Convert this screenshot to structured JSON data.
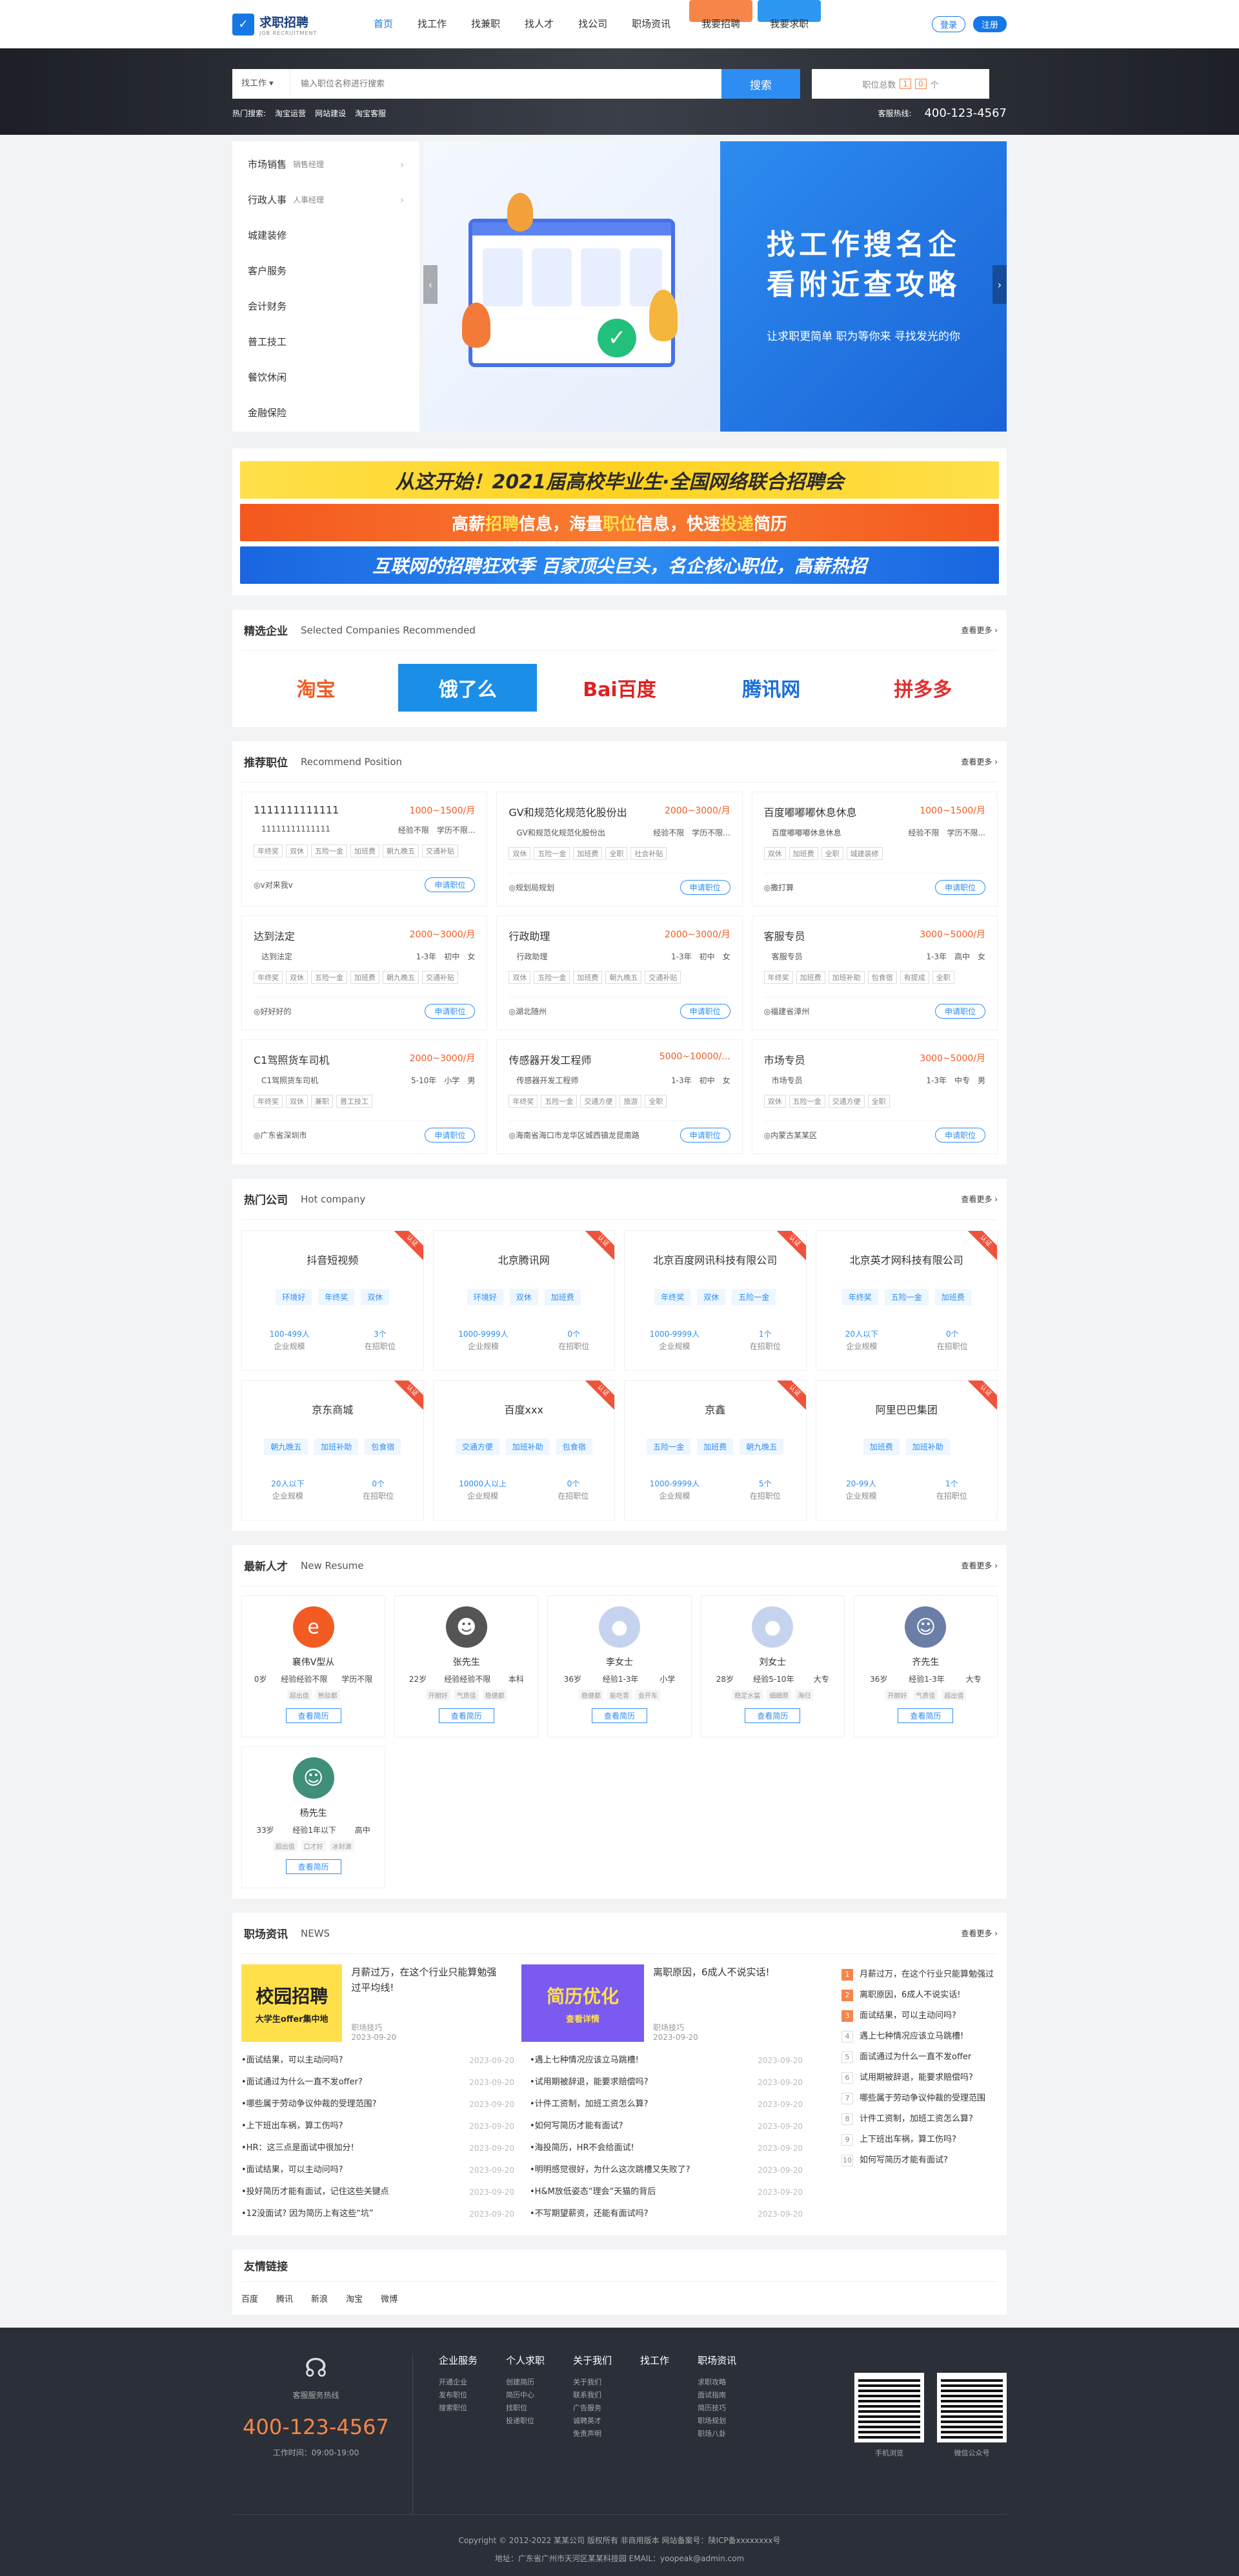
{
  "header": {
    "logo_main": "求职招聘",
    "logo_sub": "JOB RECRUITMENT",
    "nav": [
      "首页",
      "找工作",
      "找兼职",
      "找人才",
      "找公司",
      "职场资讯"
    ],
    "btn_recruit": "我要招聘",
    "btn_job": "我要求职",
    "login": "登录",
    "register": "注册"
  },
  "search": {
    "type": "找工作",
    "placeholder": "输入职位名称进行搜索",
    "button": "搜索",
    "total_label": "职位总数",
    "total_digits": [
      "1",
      "0"
    ],
    "total_unit": "个",
    "hot_label": "热门搜索:",
    "hot_terms": [
      "淘宝运营",
      "网站建设",
      "淘宝客服"
    ],
    "hotline_label": "客服热线:",
    "hotline": "400-123-4567"
  },
  "categories": [
    {
      "name": "市场销售",
      "sub": "销售经理",
      "arrow": true
    },
    {
      "name": "行政人事",
      "sub": "人事经理",
      "arrow": true
    },
    {
      "name": "城建装修",
      "sub": "",
      "arrow": false
    },
    {
      "name": "客户服务",
      "sub": "",
      "arrow": false
    },
    {
      "name": "会计财务",
      "sub": "",
      "arrow": false
    },
    {
      "name": "普工技工",
      "sub": "",
      "arrow": false
    },
    {
      "name": "餐饮休闲",
      "sub": "",
      "arrow": false
    },
    {
      "name": "金融保险",
      "sub": "",
      "arrow": false
    }
  ],
  "slide": {
    "line1": "找工作搜名企",
    "line2": "看附近查攻略",
    "tagline": "让求职更简单 职为等你来 寻找发光的你"
  },
  "ads": {
    "ad1": "从这开始！2021届高校毕业生·全国网络联合招聘会",
    "ad2": [
      "高薪",
      "招聘",
      "信息，海量",
      "职位",
      "信息，快速",
      "投递",
      "简历"
    ],
    "ad3": "互联网的招聘狂欢季   百家顶尖巨头，名企核心职位，高薪热招"
  },
  "featured": {
    "title": "精选企业",
    "en": "Selected Companies Recommended",
    "more": "查看更多 ›",
    "logos": [
      "淘宝",
      "饿了么",
      "Bai百度",
      "腾讯网",
      "拼多多"
    ]
  },
  "positions": {
    "title": "推荐职位",
    "en": "Recommend Position",
    "more": "查看更多 ›",
    "apply": "申请职位",
    "items": [
      {
        "title": "1111111111111",
        "salary": "1000~1500/月",
        "co": "11111111111111",
        "exp": "经验不限",
        "edu": "学历不限...",
        "tags": [
          "年终奖",
          "双休",
          "五险一金",
          "加班费",
          "朝九晚五",
          "交通补贴"
        ],
        "loc": "v对来我v"
      },
      {
        "title": "GV和规范化规范化股份出",
        "salary": "2000~3000/月",
        "co": "GV和规范化规范化股份出",
        "exp": "经验不限",
        "edu": "学历不限...",
        "tags": [
          "双休",
          "五险一金",
          "加班费",
          "全职",
          "社会补贴"
        ],
        "loc": "规划局规划"
      },
      {
        "title": "百度嘟嘟嘟休息休息",
        "salary": "1000~1500/月",
        "co": "百度嘟嘟嘟休息休息",
        "exp": "经验不限",
        "edu": "学历不限...",
        "tags": [
          "双休",
          "加班费",
          "全职",
          "城建装修"
        ],
        "loc": "撒打算"
      },
      {
        "title": "达到法定",
        "salary": "2000~3000/月",
        "co": "达到法定",
        "exp": "1-3年",
        "edu": "初中",
        "gender": "女",
        "tags": [
          "年终奖",
          "双休",
          "五险一金",
          "加班费",
          "朝九晚五",
          "交通补贴"
        ],
        "loc": "好好好的"
      },
      {
        "title": "行政助理",
        "salary": "2000~3000/月",
        "co": "行政助理",
        "exp": "1-3年",
        "edu": "初中",
        "gender": "女",
        "tags": [
          "双休",
          "五险一金",
          "加班费",
          "朝九晚五",
          "交通补贴"
        ],
        "loc": "湖北随州"
      },
      {
        "title": "客服专员",
        "salary": "3000~5000/月",
        "co": "客服专员",
        "exp": "1-3年",
        "edu": "高中",
        "gender": "女",
        "tags": [
          "年终奖",
          "加班费",
          "加班补助",
          "包食宿",
          "有提成",
          "全职"
        ],
        "loc": "福建省漳州"
      },
      {
        "title": "C1驾照货车司机",
        "salary": "2000~3000/月",
        "co": "C1驾照货车司机",
        "exp": "5-10年",
        "edu": "小学",
        "gender": "男",
        "tags": [
          "年终奖",
          "双休",
          "兼职",
          "普工技工"
        ],
        "loc": "广东省深圳市"
      },
      {
        "title": "传感器开发工程师",
        "salary": "5000~10000/...",
        "co": "传感器开发工程师",
        "exp": "1-3年",
        "edu": "初中",
        "gender": "女",
        "tags": [
          "年终奖",
          "五险一金",
          "交通方便",
          "旅游",
          "全职"
        ],
        "loc": "海南省海口市龙华区城西镇龙昆南路"
      },
      {
        "title": "市场专员",
        "salary": "3000~5000/月",
        "co": "市场专员",
        "exp": "1-3年",
        "edu": "中专",
        "gender": "男",
        "tags": [
          "双休",
          "五险一金",
          "交通方便",
          "全职"
        ],
        "loc": "内蒙古某某区"
      }
    ]
  },
  "hot_companies": {
    "title": "热门公司",
    "en": "Hot company",
    "more": "查看更多 ›",
    "ribbon": "认证",
    "scale_label": "企业规模",
    "jobs_label": "在招职位",
    "items": [
      {
        "name": "抖音短视频",
        "tags": [
          "环境好",
          "年终奖",
          "双休"
        ],
        "scale": "100-499人",
        "jobs": "3个"
      },
      {
        "name": "北京腾讯网",
        "tags": [
          "环境好",
          "双休",
          "加班费"
        ],
        "scale": "1000-9999人",
        "jobs": "0个"
      },
      {
        "name": "北京百度网讯科技有限公司",
        "tags": [
          "年终奖",
          "双休",
          "五险一金"
        ],
        "scale": "1000-9999人",
        "jobs": "1个"
      },
      {
        "name": "北京英才网科技有限公司",
        "tags": [
          "年终奖",
          "五险一金",
          "加班费"
        ],
        "scale": "20人以下",
        "jobs": "0个"
      },
      {
        "name": "京东商城",
        "tags": [
          "朝九晚五",
          "加班补助",
          "包食宿"
        ],
        "scale": "20人以下",
        "jobs": "0个"
      },
      {
        "name": "百度xxx",
        "tags": [
          "交通方便",
          "加班补助",
          "包食宿"
        ],
        "scale": "10000人以上",
        "jobs": "0个"
      },
      {
        "name": "京鑫",
        "tags": [
          "五险一金",
          "加班费",
          "朝九晚五"
        ],
        "scale": "1000-9999人",
        "jobs": "5个"
      },
      {
        "name": "阿里巴巴集团",
        "tags": [
          "加班费",
          "加班补助"
        ],
        "scale": "20-99人",
        "jobs": "1个"
      }
    ]
  },
  "talents": {
    "title": "最新人才",
    "en": "New Resume",
    "more": "查看更多 ›",
    "btn": "查看简历",
    "items": [
      {
        "name": "襄伟V型从",
        "age": "0岁",
        "exp": "经验经验不限",
        "edu": "学历不限",
        "tags": [
          "超出值",
          "熟验都"
        ],
        "color": "#f25b22",
        "glyph": "e"
      },
      {
        "name": "张先生",
        "age": "22岁",
        "exp": "经验经验不限",
        "edu": "本科",
        "tags": [
          "开朗好",
          "气质佳",
          "稳健都"
        ],
        "color": "#555",
        "glyph": "☻"
      },
      {
        "name": "李女士",
        "age": "36岁",
        "exp": "经验1-3年",
        "edu": "小学",
        "tags": [
          "稳健都",
          "能吃苦",
          "会开车"
        ],
        "color": "#c5d3ee",
        "glyph": "●"
      },
      {
        "name": "刘女士",
        "age": "28岁",
        "exp": "经验5-10年",
        "edu": "大专",
        "tags": [
          "稳定水富",
          "细细原",
          "海归"
        ],
        "color": "#c5d3ee",
        "glyph": "●"
      },
      {
        "name": "齐先生",
        "age": "36岁",
        "exp": "经验1-3年",
        "edu": "大专",
        "tags": [
          "开朗好",
          "气质佳",
          "超出值"
        ],
        "color": "#6b7ea8",
        "glyph": "☺"
      },
      {
        "name": "杨先生",
        "age": "33岁",
        "exp": "经验1年以下",
        "edu": "高中",
        "tags": [
          "超出值",
          "口才好",
          "冰封源"
        ],
        "color": "#3f8f7a",
        "glyph": "☺"
      }
    ]
  },
  "news": {
    "title": "职场资讯",
    "en": "NEWS",
    "more": "查看更多 ›",
    "featured": [
      {
        "img_text": "校园招聘",
        "img_sub": "大学生offer集中地",
        "title": "月薪过万，在这个行业只能算勉强过平均线!",
        "cat": "职场技巧",
        "date": "2023-09-20"
      },
      {
        "img_text": "简历优化",
        "img_sub": "查看详情",
        "title": "离职原因，6成人不说实话!",
        "cat": "职场技巧",
        "date": "2023-09-20"
      }
    ],
    "list_left": [
      [
        "面试结果，可以主动问吗?",
        "2023-09-20"
      ],
      [
        "面试通过为什么一直不发offer?",
        "2023-09-20"
      ],
      [
        "哪些属于劳动争议仲裁的受理范围?",
        "2023-09-20"
      ],
      [
        "上下班出车祸，算工伤吗?",
        "2023-09-20"
      ],
      [
        "HR：这三点是面试中很加分!",
        "2023-09-20"
      ],
      [
        "面试结果，可以主动问吗?",
        "2023-09-20"
      ],
      [
        "投好简历才能有面试，记住这些关键点",
        "2023-09-20"
      ],
      [
        "12没面试? 因为简历上有这些“坑”",
        "2023-09-20"
      ]
    ],
    "list_mid": [
      [
        "遇上七种情况应该立马跳槽!",
        "2023-09-20"
      ],
      [
        "试用期被辞退，能要求赔偿吗?",
        "2023-09-20"
      ],
      [
        "计件工资制，加班工资怎么算?",
        "2023-09-20"
      ],
      [
        "如何写简历才能有面试?",
        "2023-09-20"
      ],
      [
        "海投简历，HR不会给面试!",
        "2023-09-20"
      ],
      [
        "明明感觉很好，为什么这次跳槽又失败了?",
        "2023-09-20"
      ],
      [
        "H&M放低姿态“理会”天猫的背后",
        "2023-09-20"
      ],
      [
        "不写期望薪资，还能有面试吗?",
        "2023-09-20"
      ]
    ],
    "rank": [
      "月薪过万，在这个行业只能算勉强过",
      "离职原因，6成人不说实话!",
      "面试结果，可以主动问吗?",
      "遇上七种情况应该立马跳槽!",
      "面试通过为什么一直不发offer",
      "试用期被辞退，能要求赔偿吗?",
      "哪些属于劳动争议仲裁的受理范围",
      "计件工资制，加班工资怎么算?",
      "上下班出车祸，算工伤吗?",
      "如何写简历才能有面试?"
    ]
  },
  "friend_links": {
    "title": "友情链接",
    "items": [
      "百度",
      "腾讯",
      "新浪",
      "淘宝",
      "微博"
    ]
  },
  "footer": {
    "service_label": "客服服务热线",
    "tel": "400-123-4567",
    "hours": "工作时间：09:00-19:00",
    "cols": [
      {
        "title": "企业服务",
        "items": [
          "开通企业",
          "发布职位",
          "搜索职位"
        ]
      },
      {
        "title": "个人求职",
        "items": [
          "创建简历",
          "简历中心",
          "找职位",
          "投递职位"
        ]
      },
      {
        "title": "关于我们",
        "items": [
          "关于我们",
          "联系我们",
          "广告服务",
          "诚聘英才",
          "免责声明"
        ]
      },
      {
        "title": "找工作",
        "items": []
      },
      {
        "title": "职场资讯",
        "items": [
          "求职攻略",
          "面试指南",
          "简历技巧",
          "职场规划",
          "职场八卦"
        ]
      }
    ],
    "qr": [
      "手机浏览",
      "微信公众号"
    ],
    "copyright": "Copyright © 2012-2022 某某公司 版权所有 非商用版本 网站备案号：陕ICP备xxxxxxxx号",
    "address": "地址：广东省广州市天河区某某科技园 EMAIL：yoopeak@admin.com"
  }
}
